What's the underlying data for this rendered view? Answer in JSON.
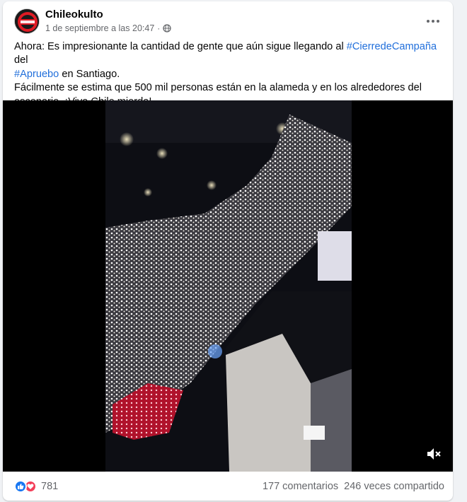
{
  "post": {
    "author": "Chileokulto",
    "avatar_text": "CHILE OKULTO",
    "timestamp": "1 de septiembre a las 20:47",
    "privacy_icon": "globe-icon",
    "more_icon": "ellipsis-icon",
    "text": {
      "line1_prefix": "Ahora: Es impresionante la cantidad de gente que aún sigue llegando al ",
      "hashtag1": "#CierredeCampaña",
      "line1_suffix": " del",
      "hashtag2": "#Apruebo",
      "line2_suffix": " en Santiago.",
      "line3": "Fácilmente se estima que 500 mil personas están en la alameda y en los alrededores del",
      "line4": "escenario. ¡Viva Chile mierda!"
    }
  },
  "video": {
    "description_icon": "mute-icon",
    "muted": true
  },
  "footer": {
    "reaction_count": "781",
    "reaction_icons": [
      "like-icon",
      "love-icon"
    ],
    "comments": "177 comentarios",
    "shares": "246 veces compartido"
  },
  "colors": {
    "link": "#216fdb",
    "secondary_text": "#65676b",
    "like": "#1877f2",
    "love": "#f33e58"
  }
}
